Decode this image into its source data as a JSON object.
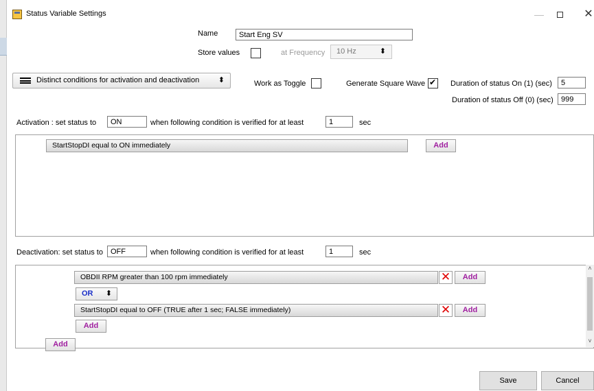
{
  "window": {
    "title": "Status Variable Settings",
    "minimize": "—",
    "close": "✕"
  },
  "name": {
    "label": "Name",
    "value": "Start Eng SV"
  },
  "store": {
    "label": "Store values",
    "frequency_label": "at Frequency",
    "frequency_value": "10 Hz",
    "frequency_arrow": "⬍"
  },
  "mode": {
    "value": "Distinct conditions for activation and deactivation",
    "arrow": "⬍"
  },
  "toggle": {
    "label": "Work as Toggle"
  },
  "square_wave": {
    "label": "Generate Square Wave",
    "checked": true
  },
  "duration_on": {
    "label": "Duration of status On (1)  (sec)",
    "value": "5"
  },
  "duration_off": {
    "label": "Duration of status Off (0)  (sec)",
    "value": "999"
  },
  "activation": {
    "label": "Activation : set status to",
    "status_value": "ON",
    "condition_label": "when following condition is   verified  for at least",
    "duration": "1",
    "unit": "sec",
    "conditions": [
      {
        "text": "StartStopDI   equal to  ON  immediately"
      }
    ],
    "add_label": "Add"
  },
  "deactivation": {
    "label": "Deactivation: set status to",
    "status_value": "OFF",
    "condition_label": "when following condition is   verified  for at least",
    "duration": "1",
    "unit": "sec",
    "conditions": [
      {
        "text": "OBDII RPM   greater than   100 rpm   immediately"
      },
      {
        "text": "StartStopDI   equal to   OFF   (TRUE after  1 sec;  FALSE immediately)"
      }
    ],
    "operator": "OR",
    "operator_arrow": "⬍",
    "add_label": "Add",
    "scroll_up": "˄",
    "scroll_down": "˅"
  },
  "footer": {
    "save": "Save",
    "cancel": "Cancel"
  }
}
